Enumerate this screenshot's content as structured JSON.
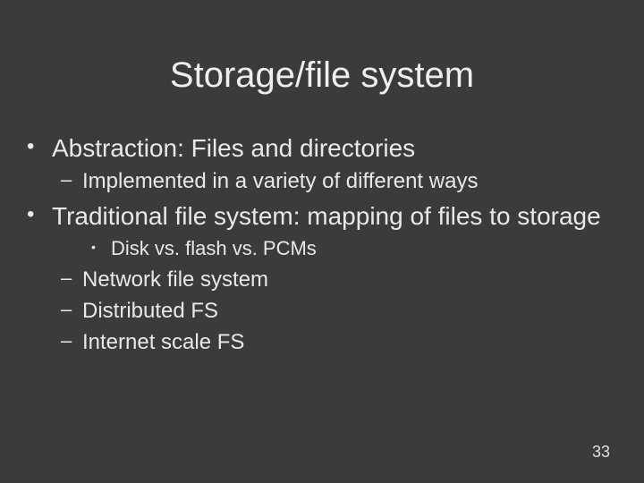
{
  "slide": {
    "title": "Storage/file system",
    "bullets": {
      "b1": "Abstraction: Files and directories",
      "b1_1": "Implemented in a variety of different ways",
      "b2": "Traditional file system: mapping of files to storage",
      "b2_1": "Disk vs. flash vs. PCMs",
      "b2_2": "Network file system",
      "b2_3": "Distributed FS",
      "b2_4": "Internet scale FS"
    },
    "page_number": "33"
  }
}
